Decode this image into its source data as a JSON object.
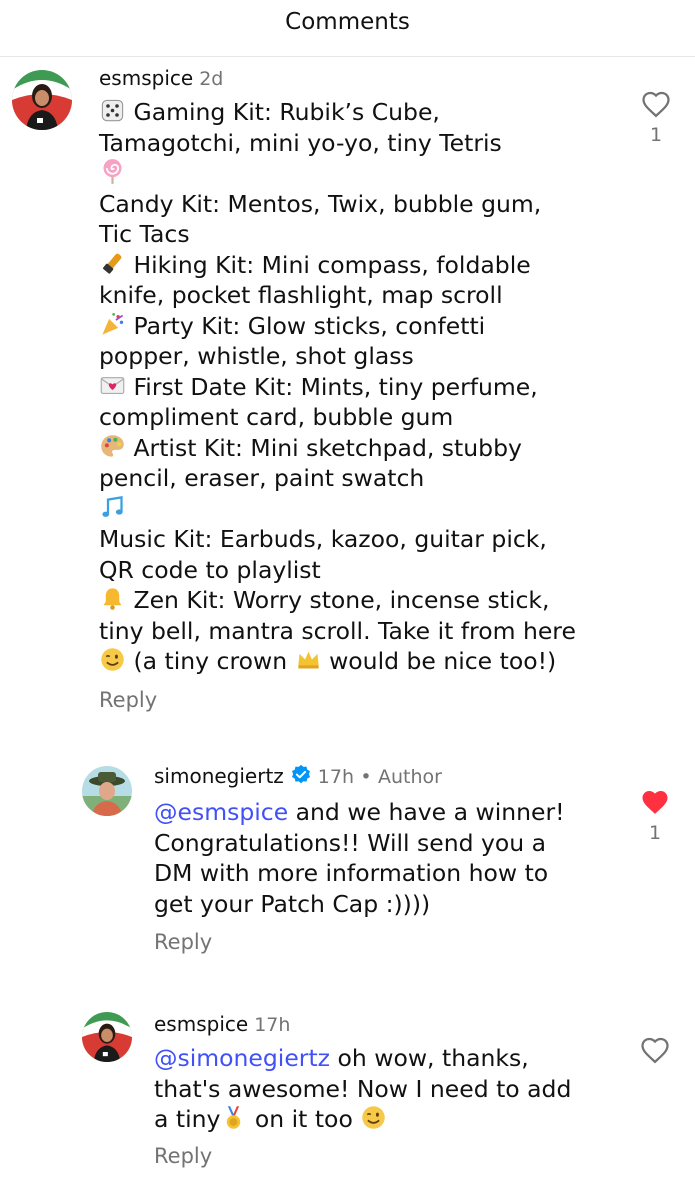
{
  "header": {
    "title": "Comments"
  },
  "comments": [
    {
      "username": "esmspice",
      "time": "2d",
      "likes": "1",
      "liked": false,
      "lines": [
        {
          "emoji": "dice",
          "text": "Gaming Kit: Rubik’s Cube,"
        },
        {
          "text": "Tamagotchi, mini yo-yo, tiny Tetris"
        },
        {
          "emoji": "lollipop",
          "text": ""
        },
        {
          "text": "Candy Kit: Mentos, Twix, bubble gum,"
        },
        {
          "text": "Tic Tacs"
        },
        {
          "emoji": "flashlight",
          "text": "Hiking Kit: Mini compass, foldable"
        },
        {
          "text": "knife, pocket flashlight, map scroll"
        },
        {
          "emoji": "party-popper",
          "text": "Party Kit: Glow sticks, confetti"
        },
        {
          "text": "popper, whistle, shot glass"
        },
        {
          "emoji": "love-letter",
          "text": "First Date Kit: Mints, tiny perfume,"
        },
        {
          "text": "compliment card, bubble gum"
        },
        {
          "emoji": "palette",
          "text": "Artist Kit: Mini sketchpad, stubby"
        },
        {
          "text": "pencil, eraser, paint swatch"
        },
        {
          "emoji": "music-notes",
          "text": ""
        },
        {
          "text": "Music Kit: Earbuds, kazoo, guitar pick,"
        },
        {
          "text": "QR code to playlist"
        },
        {
          "emoji": "bell",
          "text": "Zen Kit: Worry stone, incense stick,"
        },
        {
          "text": "tiny bell, mantra scroll. Take it from here"
        }
      ],
      "last_line": {
        "emoji_start": "wink",
        "part1": "(a tiny crown",
        "emoji_mid": "crown",
        "part2": "would be nice too!)"
      },
      "reply_label": "Reply"
    },
    {
      "username": "simonegiertz",
      "verified": true,
      "time": "17h",
      "separator": "•",
      "author_label": "Author",
      "likes": "1",
      "liked": true,
      "mention": "@esmspice",
      "first_line_rest": " and we have a winner!",
      "lines": [
        "Congratulations!! Will send you a",
        "DM with more information how to",
        "get your Patch Cap :))))"
      ],
      "reply_label": "Reply"
    },
    {
      "username": "esmspice",
      "time": "17h",
      "liked": false,
      "mention": "@simonegiertz",
      "first_line_rest": " oh wow, thanks,",
      "second_line": "that's awesome! Now I need to add",
      "third_line": {
        "part1": "a tiny",
        "emoji_mid": "medal",
        "part2": " on it too",
        "emoji_end": "wink"
      },
      "reply_label": "Reply"
    }
  ],
  "colors": {
    "mention": "#4150f7",
    "muted": "#737373",
    "like_red": "#ff3040",
    "verified_blue": "#0095f6"
  }
}
